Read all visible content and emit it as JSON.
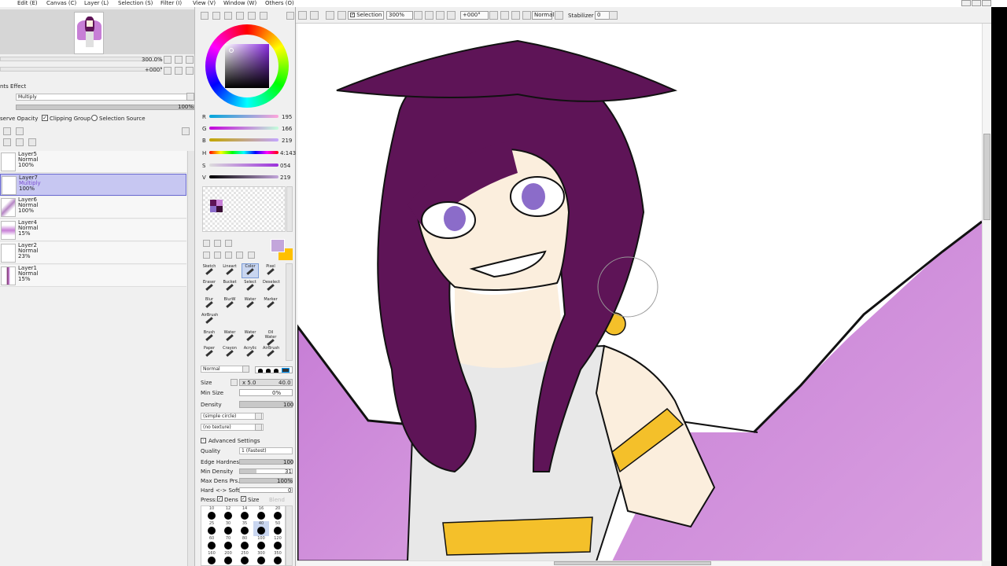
{
  "menu": {
    "items": [
      "Edit (E)",
      "Canvas (C)",
      "Layer (L)",
      "Selection (S)",
      "Filter (I)",
      "View (V)",
      "Window (W)",
      "Others (O)"
    ]
  },
  "navigator": {
    "zoom": "300.0%",
    "angle": "+000°"
  },
  "layer_props": {
    "effect_label": "nts Effect",
    "blend_mode": "Multiply",
    "opacity": "100%",
    "preserve_opacity": "serve Opacity",
    "clipping_group": "Clipping Group",
    "selection_source": "Selection Source"
  },
  "layers": [
    {
      "name": "Layer5",
      "mode": "Normal",
      "opacity": "100%"
    },
    {
      "name": "Layer7",
      "mode": "Multiply",
      "opacity": "100%"
    },
    {
      "name": "Layer6",
      "mode": "Normal",
      "opacity": "100%"
    },
    {
      "name": "Layer4",
      "mode": "Normal",
      "opacity": "15%"
    },
    {
      "name": "Layer2",
      "mode": "Normal",
      "opacity": "23%"
    },
    {
      "name": "Layer1",
      "mode": "Normal",
      "opacity": "15%"
    }
  ],
  "color": {
    "r": "195",
    "g": "166",
    "b": "219",
    "h": "4:143",
    "s": "054",
    "v": "219",
    "current": "#c3a6db",
    "secondary": "#ffc000"
  },
  "brush_tools": [
    [
      "Sketch",
      "Lineart",
      "Color",
      "Pixel"
    ],
    [
      "Eraser",
      "Bucket",
      "Select",
      "Deselect"
    ],
    [
      "Blur",
      "BlurW",
      "Water",
      "Marker"
    ],
    [
      "AirBrush",
      "",
      "",
      ""
    ],
    [
      "Brush",
      "Water",
      "Water",
      "Oil Water"
    ],
    [
      "Paper",
      "Crayon",
      "Acrylic",
      "AirBrush"
    ]
  ],
  "brush_settings": {
    "blend": "Normal",
    "size_label": "Size",
    "size_mult": "x 5.0",
    "size_value": "40.0",
    "min_size_label": "Min Size",
    "min_size": "0%",
    "density_label": "Density",
    "density": "100",
    "shape": "(simple circle)",
    "texture": "(no texture)",
    "advanced": "Advanced Settings",
    "quality_label": "Quality",
    "quality": "1 (Fastest)",
    "edge_label": "Edge Hardness",
    "edge": "100",
    "min_density_label": "Min Density",
    "min_density": "31",
    "max_dens_label": "Max Dens Prs.",
    "max_dens": "100%",
    "hard_soft_label": "Hard <-> Soft",
    "hard_soft": "0",
    "press_label": "Press:",
    "press_dens": "Dens",
    "press_size": "Size",
    "press_blend": "Blend"
  },
  "dot_sizes": [
    "10",
    "12",
    "14",
    "16",
    "20",
    "25",
    "30",
    "35",
    "40",
    "50",
    "60",
    "70",
    "80",
    "100",
    "120",
    "160",
    "200",
    "250",
    "300",
    "350"
  ],
  "toolbar": {
    "selection_label": "Selection",
    "zoom": "300%",
    "angle": "+000°",
    "mode": "Normal",
    "stabilizer_label": "Stabilizer",
    "stabilizer": "0"
  },
  "colors": {
    "hair": "#5e1457",
    "skin": "#fbeedd",
    "wing": "#c77ed6",
    "gold": "#f4c02a",
    "robe": "#e8e8e8",
    "eye": "#8b6cc9"
  }
}
